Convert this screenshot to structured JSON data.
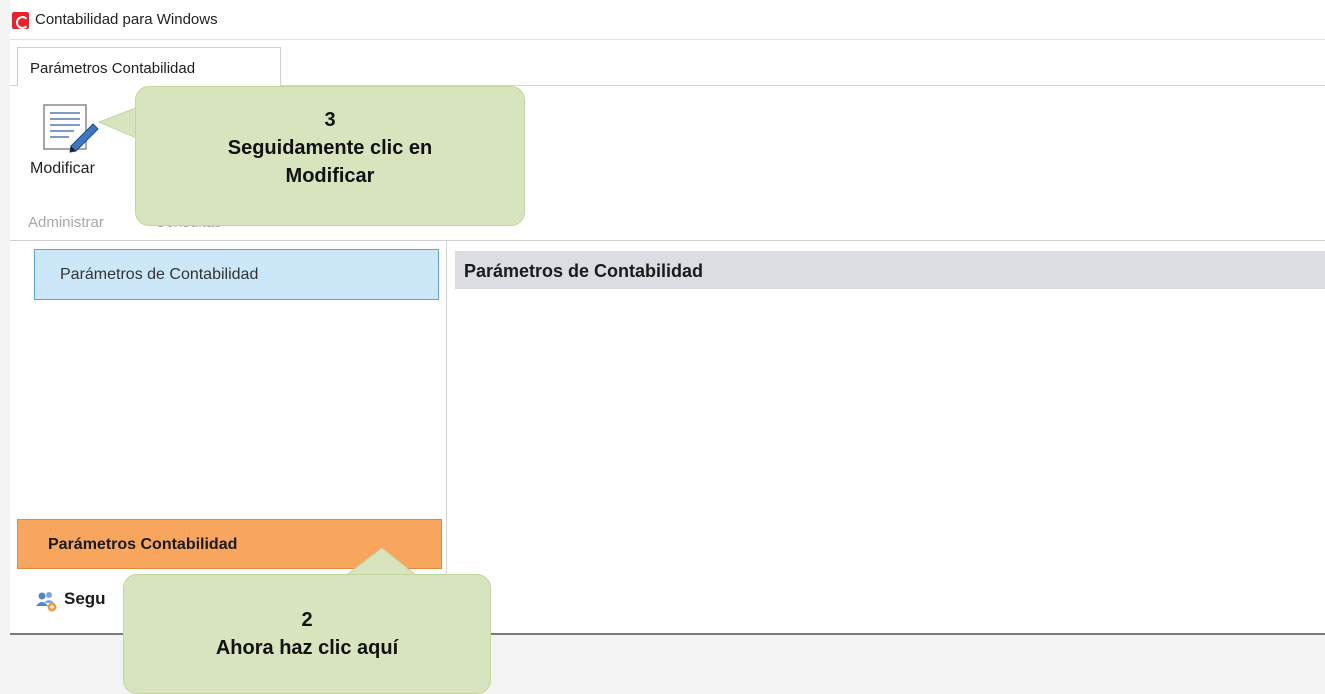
{
  "window": {
    "title": "Contabilidad para Windows"
  },
  "tabs": [
    {
      "label": "Parámetros Contabilidad"
    }
  ],
  "ribbon": {
    "modify_button": {
      "label": "Modificar",
      "icon": "edit-document-icon"
    },
    "group_label": "Administrar",
    "group_label2": "Consultas"
  },
  "sidebar": {
    "selected_item": "Parámetros de Contabilidad",
    "section_bar": "Parámetros Contabilidad",
    "next_section": {
      "label": "Segu",
      "icon": "users-gear-icon"
    }
  },
  "content": {
    "header": "Parámetros de Contabilidad"
  },
  "callouts": {
    "step3": {
      "number": "3",
      "line1": "Seguidamente clic en",
      "line2": "Modificar"
    },
    "step2": {
      "number": "2",
      "line1": "Ahora haz clic aquí"
    }
  },
  "colors": {
    "accent_orange": "#f8a65d",
    "selected_blue": "#cce8f8",
    "callout_green": "#d7e4bd",
    "logo_red": "#e8232a"
  }
}
